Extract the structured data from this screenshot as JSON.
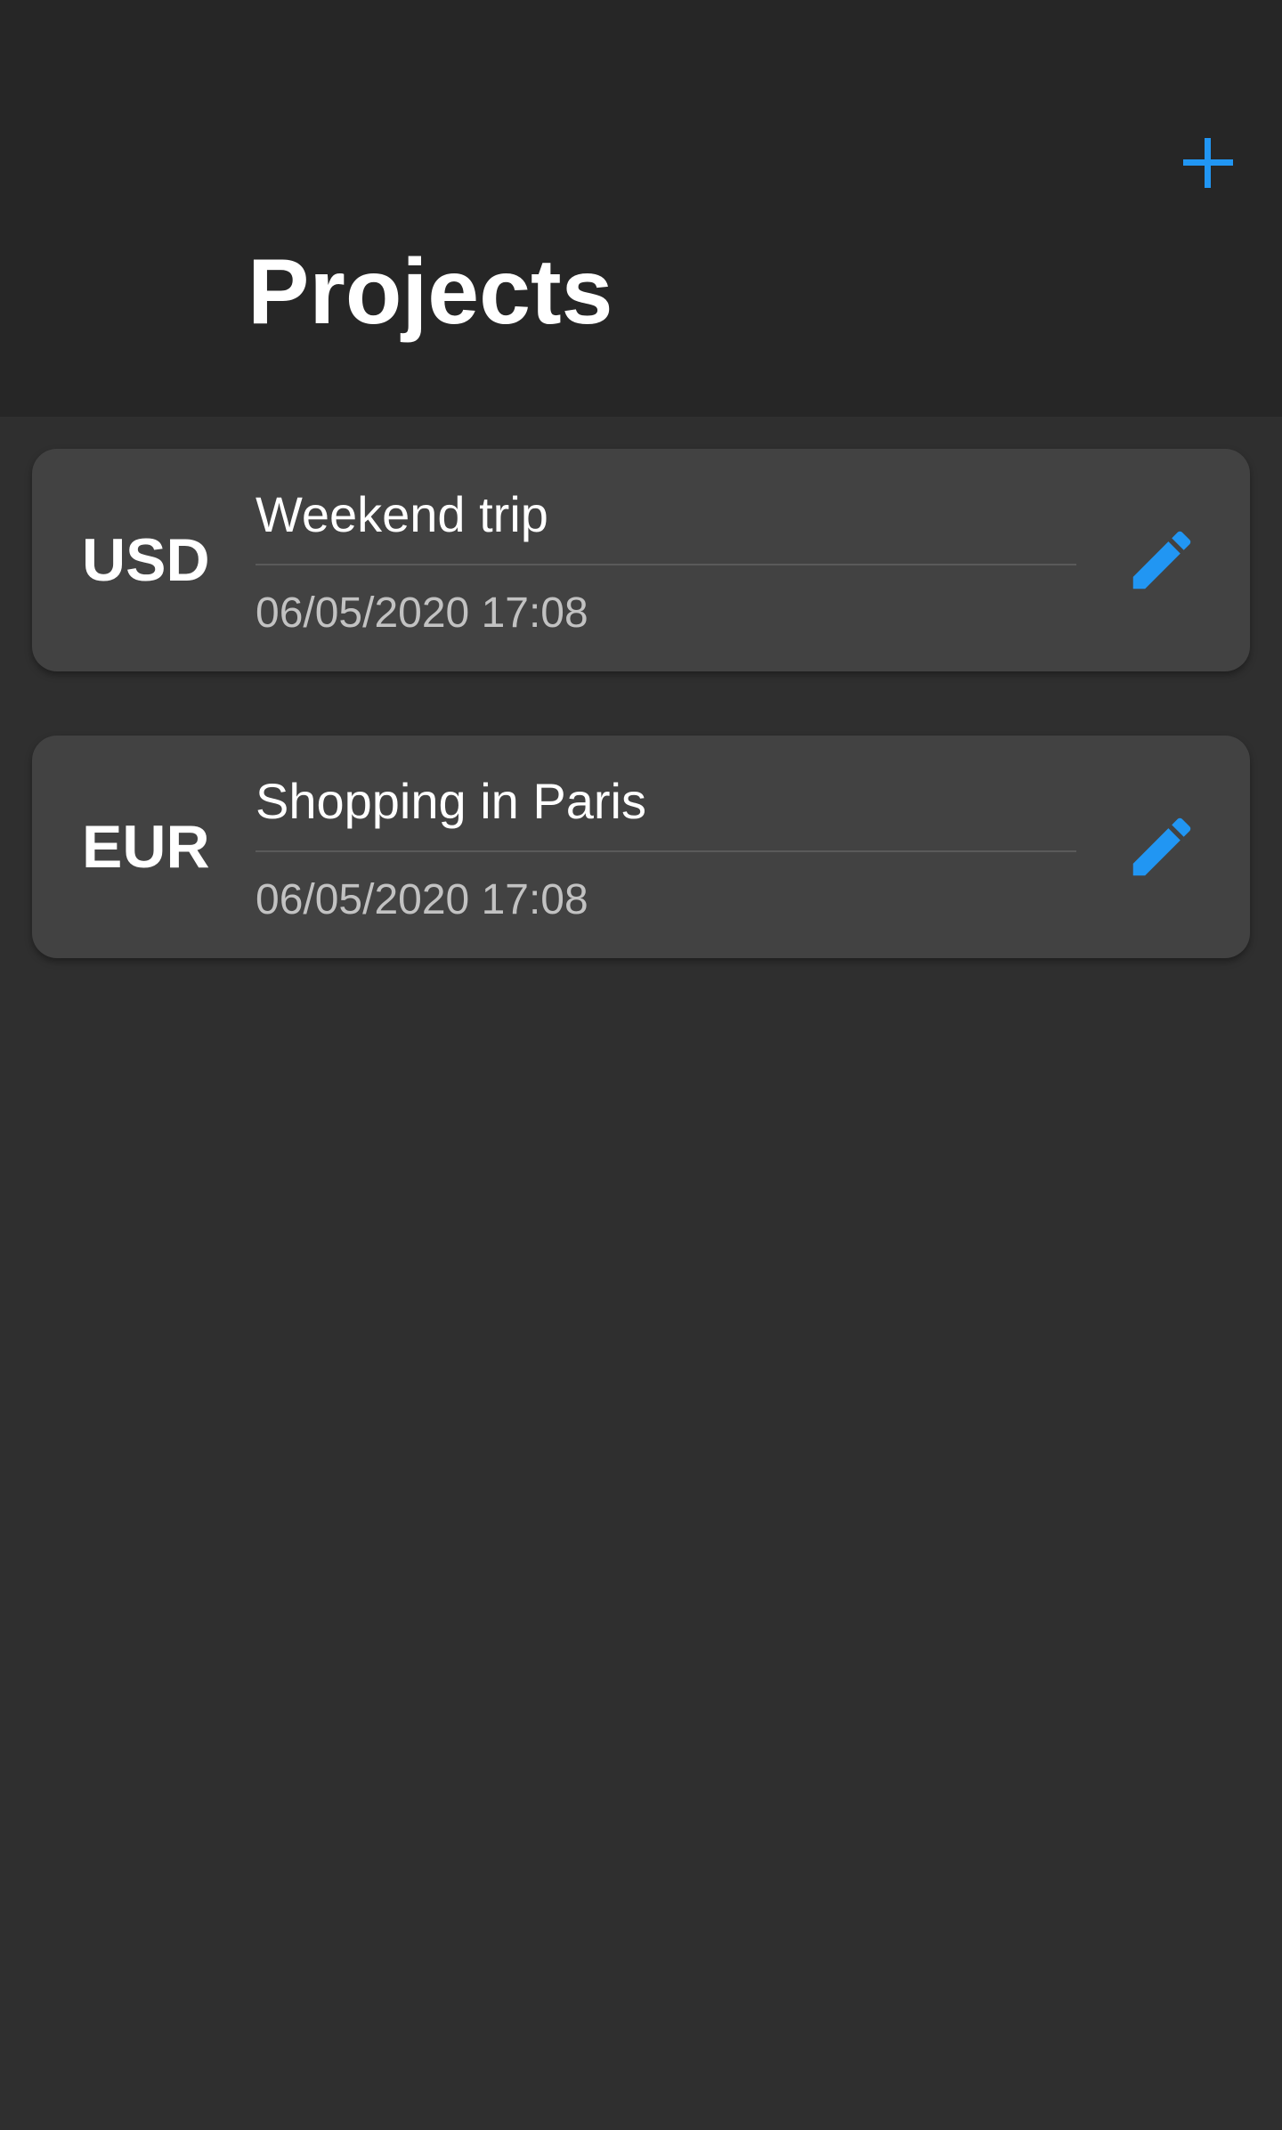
{
  "header": {
    "title": "Projects",
    "add_icon": "plus-icon"
  },
  "projects": [
    {
      "currency": "USD",
      "name": "Weekend trip",
      "date": "06/05/2020 17:08",
      "edit_icon": "pencil-icon"
    },
    {
      "currency": "EUR",
      "name": "Shopping in Paris",
      "date": "06/05/2020 17:08",
      "edit_icon": "pencil-icon"
    }
  ],
  "colors": {
    "accent": "#2196f3",
    "header_background": "#262626",
    "page_background": "#2f2f2f",
    "card_background": "#424242",
    "primary_text": "#ffffff",
    "secondary_text": "#c2c2c2"
  }
}
